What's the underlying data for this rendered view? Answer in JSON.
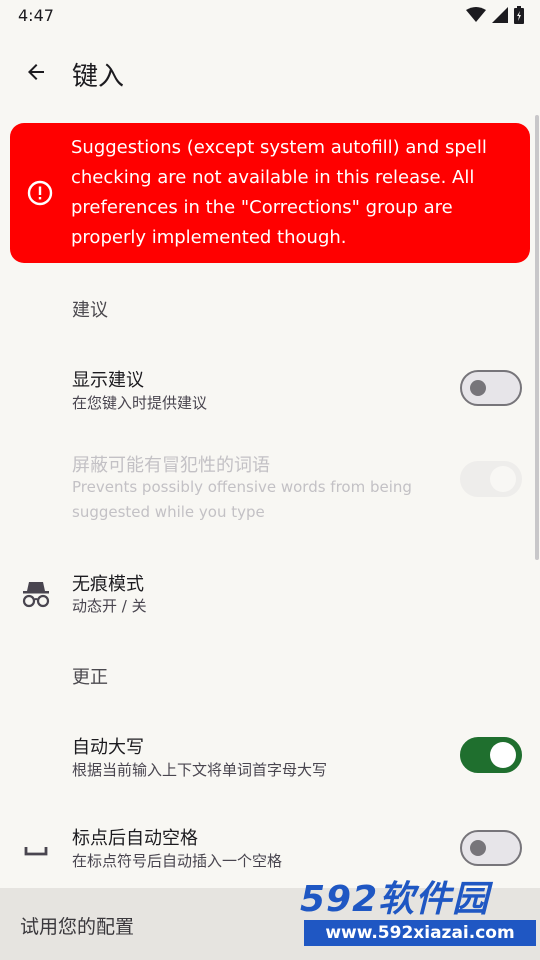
{
  "status_bar": {
    "time": "4:47",
    "icons": [
      "wifi-icon",
      "signal-icon",
      "battery-icon"
    ]
  },
  "app_bar": {
    "back_icon": "arrow-back-icon",
    "title": "键入"
  },
  "banner": {
    "icon": "error-icon",
    "text": "Suggestions (except system autofill) and spell checking are not available in this release. All preferences in the \"Corrections\" group are properly implemented though.",
    "color": "#ff0000"
  },
  "sections": {
    "suggestions_header": "建议",
    "corrections_header": "更正"
  },
  "prefs": {
    "show_suggestions": {
      "title": "显示建议",
      "summary": "在您键入时提供建议",
      "checked": false
    },
    "block_offensive": {
      "title": "屏蔽可能有冒犯性的词语",
      "summary": "Prevents possibly offensive words from being suggested while you type",
      "checked": true,
      "enabled": false
    },
    "incognito": {
      "icon": "incognito-icon",
      "title": "无痕模式",
      "summary": "动态开 / 关"
    },
    "auto_capitalize": {
      "title": "自动大写",
      "summary": "根据当前输入上下文将单词首字母大写",
      "checked": true
    },
    "auto_space": {
      "icon": "space-bar-icon",
      "title": "标点后自动空格",
      "summary": "在标点符号后自动插入一个空格",
      "checked": false
    }
  },
  "bottom_bar": {
    "label": "试用您的配置"
  },
  "watermark": {
    "top": "592软件园",
    "bottom": "www.592xiazai.com"
  },
  "colors": {
    "accent_green": "#1f6f2e",
    "background": "#f8f7f3",
    "watermark_blue": "#1f57c3"
  }
}
